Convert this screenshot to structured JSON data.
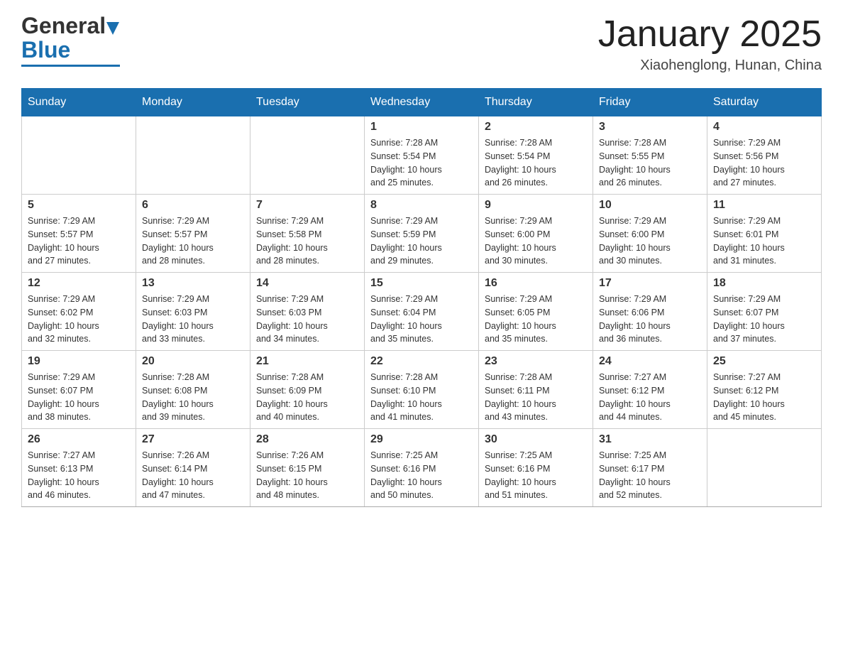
{
  "header": {
    "logo_general": "General",
    "logo_blue": "Blue",
    "month_title": "January 2025",
    "location": "Xiaohenglong, Hunan, China"
  },
  "calendar": {
    "days_of_week": [
      "Sunday",
      "Monday",
      "Tuesday",
      "Wednesday",
      "Thursday",
      "Friday",
      "Saturday"
    ],
    "weeks": [
      [
        {
          "day": "",
          "info": ""
        },
        {
          "day": "",
          "info": ""
        },
        {
          "day": "",
          "info": ""
        },
        {
          "day": "1",
          "info": "Sunrise: 7:28 AM\nSunset: 5:54 PM\nDaylight: 10 hours\nand 25 minutes."
        },
        {
          "day": "2",
          "info": "Sunrise: 7:28 AM\nSunset: 5:54 PM\nDaylight: 10 hours\nand 26 minutes."
        },
        {
          "day": "3",
          "info": "Sunrise: 7:28 AM\nSunset: 5:55 PM\nDaylight: 10 hours\nand 26 minutes."
        },
        {
          "day": "4",
          "info": "Sunrise: 7:29 AM\nSunset: 5:56 PM\nDaylight: 10 hours\nand 27 minutes."
        }
      ],
      [
        {
          "day": "5",
          "info": "Sunrise: 7:29 AM\nSunset: 5:57 PM\nDaylight: 10 hours\nand 27 minutes."
        },
        {
          "day": "6",
          "info": "Sunrise: 7:29 AM\nSunset: 5:57 PM\nDaylight: 10 hours\nand 28 minutes."
        },
        {
          "day": "7",
          "info": "Sunrise: 7:29 AM\nSunset: 5:58 PM\nDaylight: 10 hours\nand 28 minutes."
        },
        {
          "day": "8",
          "info": "Sunrise: 7:29 AM\nSunset: 5:59 PM\nDaylight: 10 hours\nand 29 minutes."
        },
        {
          "day": "9",
          "info": "Sunrise: 7:29 AM\nSunset: 6:00 PM\nDaylight: 10 hours\nand 30 minutes."
        },
        {
          "day": "10",
          "info": "Sunrise: 7:29 AM\nSunset: 6:00 PM\nDaylight: 10 hours\nand 30 minutes."
        },
        {
          "day": "11",
          "info": "Sunrise: 7:29 AM\nSunset: 6:01 PM\nDaylight: 10 hours\nand 31 minutes."
        }
      ],
      [
        {
          "day": "12",
          "info": "Sunrise: 7:29 AM\nSunset: 6:02 PM\nDaylight: 10 hours\nand 32 minutes."
        },
        {
          "day": "13",
          "info": "Sunrise: 7:29 AM\nSunset: 6:03 PM\nDaylight: 10 hours\nand 33 minutes."
        },
        {
          "day": "14",
          "info": "Sunrise: 7:29 AM\nSunset: 6:03 PM\nDaylight: 10 hours\nand 34 minutes."
        },
        {
          "day": "15",
          "info": "Sunrise: 7:29 AM\nSunset: 6:04 PM\nDaylight: 10 hours\nand 35 minutes."
        },
        {
          "day": "16",
          "info": "Sunrise: 7:29 AM\nSunset: 6:05 PM\nDaylight: 10 hours\nand 35 minutes."
        },
        {
          "day": "17",
          "info": "Sunrise: 7:29 AM\nSunset: 6:06 PM\nDaylight: 10 hours\nand 36 minutes."
        },
        {
          "day": "18",
          "info": "Sunrise: 7:29 AM\nSunset: 6:07 PM\nDaylight: 10 hours\nand 37 minutes."
        }
      ],
      [
        {
          "day": "19",
          "info": "Sunrise: 7:29 AM\nSunset: 6:07 PM\nDaylight: 10 hours\nand 38 minutes."
        },
        {
          "day": "20",
          "info": "Sunrise: 7:28 AM\nSunset: 6:08 PM\nDaylight: 10 hours\nand 39 minutes."
        },
        {
          "day": "21",
          "info": "Sunrise: 7:28 AM\nSunset: 6:09 PM\nDaylight: 10 hours\nand 40 minutes."
        },
        {
          "day": "22",
          "info": "Sunrise: 7:28 AM\nSunset: 6:10 PM\nDaylight: 10 hours\nand 41 minutes."
        },
        {
          "day": "23",
          "info": "Sunrise: 7:28 AM\nSunset: 6:11 PM\nDaylight: 10 hours\nand 43 minutes."
        },
        {
          "day": "24",
          "info": "Sunrise: 7:27 AM\nSunset: 6:12 PM\nDaylight: 10 hours\nand 44 minutes."
        },
        {
          "day": "25",
          "info": "Sunrise: 7:27 AM\nSunset: 6:12 PM\nDaylight: 10 hours\nand 45 minutes."
        }
      ],
      [
        {
          "day": "26",
          "info": "Sunrise: 7:27 AM\nSunset: 6:13 PM\nDaylight: 10 hours\nand 46 minutes."
        },
        {
          "day": "27",
          "info": "Sunrise: 7:26 AM\nSunset: 6:14 PM\nDaylight: 10 hours\nand 47 minutes."
        },
        {
          "day": "28",
          "info": "Sunrise: 7:26 AM\nSunset: 6:15 PM\nDaylight: 10 hours\nand 48 minutes."
        },
        {
          "day": "29",
          "info": "Sunrise: 7:25 AM\nSunset: 6:16 PM\nDaylight: 10 hours\nand 50 minutes."
        },
        {
          "day": "30",
          "info": "Sunrise: 7:25 AM\nSunset: 6:16 PM\nDaylight: 10 hours\nand 51 minutes."
        },
        {
          "day": "31",
          "info": "Sunrise: 7:25 AM\nSunset: 6:17 PM\nDaylight: 10 hours\nand 52 minutes."
        },
        {
          "day": "",
          "info": ""
        }
      ]
    ]
  }
}
